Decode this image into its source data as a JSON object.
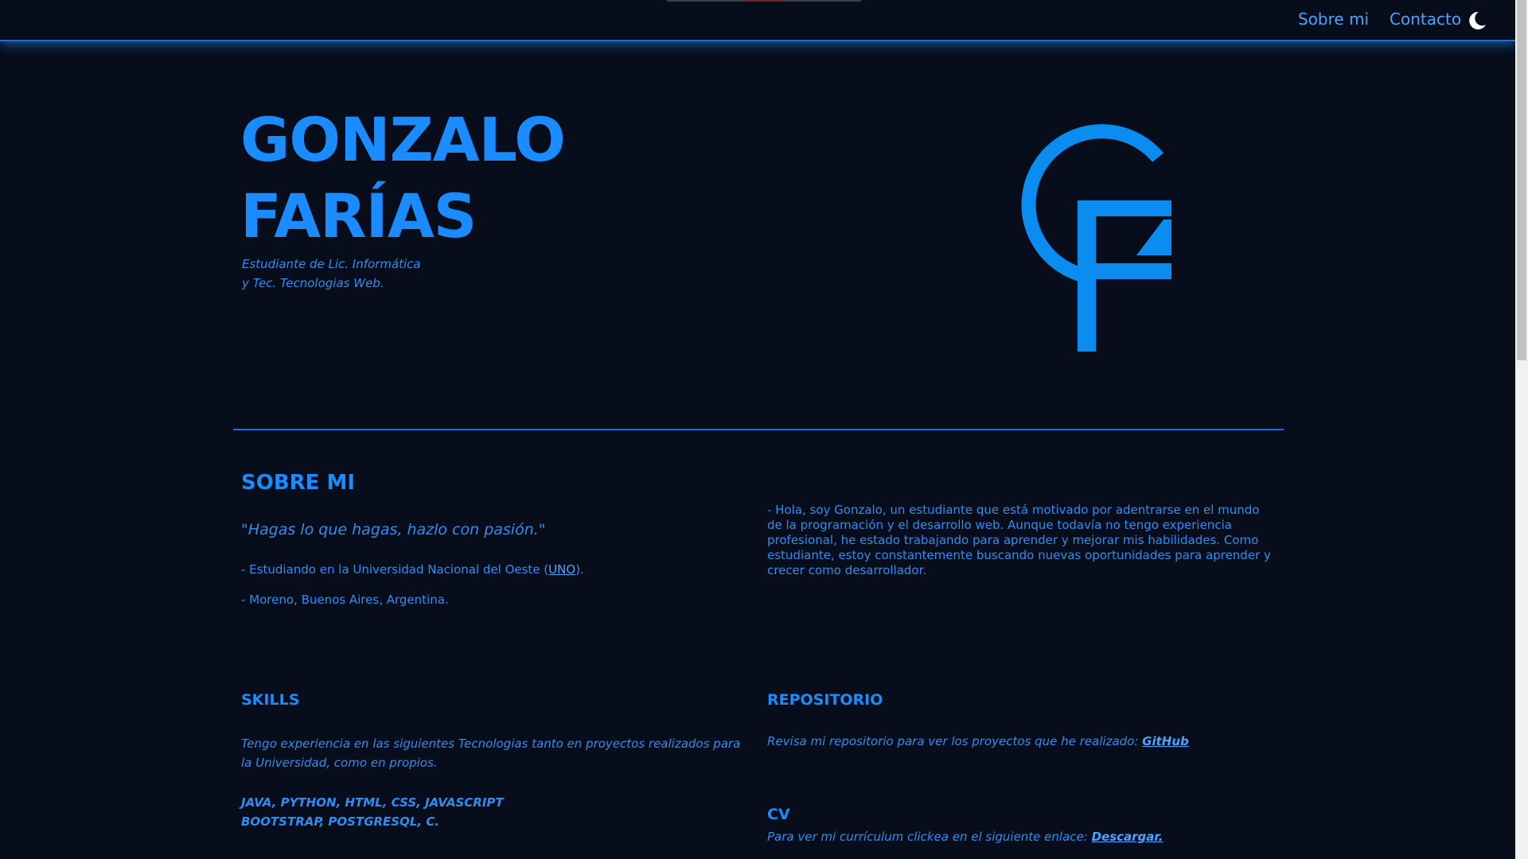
{
  "nav": {
    "about_label": "Sobre mi",
    "contact_label": "Contacto",
    "theme_icon": "moon-icon"
  },
  "hero": {
    "first_name": "GONZALO",
    "last_name": "FARÍAS",
    "subtitle_line1": "Estudiante de Lic. Informática",
    "subtitle_line2": "y Tec. Tecnologias Web.",
    "logo_icon": "gf-monogram-logo"
  },
  "about": {
    "heading": "SOBRE MI",
    "quote": "\"Hagas lo que hagas, hazlo con pasión.\"",
    "uni_prefix": "- Estudiando en la Universidad Nacional del Oeste (",
    "uni_link": "UNO",
    "uni_suffix": ").",
    "location": "- Moreno, Buenos Aires, Argentina.",
    "bio": "- Hola, soy Gonzalo, un estudiante que está motivado por adentrarse en el mundo de la programación y el desarrollo web. Aunque todavía no tengo experiencia profesional, he estado trabajando para aprender y mejorar mis habilidades. Como estudiante, estoy constantemente buscando nuevas oportunidades para aprender y crecer como desarrollador."
  },
  "skills": {
    "heading": "SKILLS",
    "text": "Tengo experiencia en las siguientes Tecnologias tanto en proyectos realizados para la Universidad, como en propios.",
    "list_line1": "JAVA, PYTHON, HTML, CSS, JAVASCRIPT",
    "list_line2": "BOOTSTRAP, POSTGRESQL, C."
  },
  "repo": {
    "heading": "REPOSITORIO",
    "text": "Revisa mi repositorio para ver los proyectos que he realizado: ",
    "link": "GitHub"
  },
  "cv": {
    "heading": "CV",
    "text": "Para ver mi currículum clickea en el siguiente enlace: ",
    "link": "Descargar."
  },
  "colors": {
    "background": "#070d1a",
    "accent": "#1a8cff"
  }
}
